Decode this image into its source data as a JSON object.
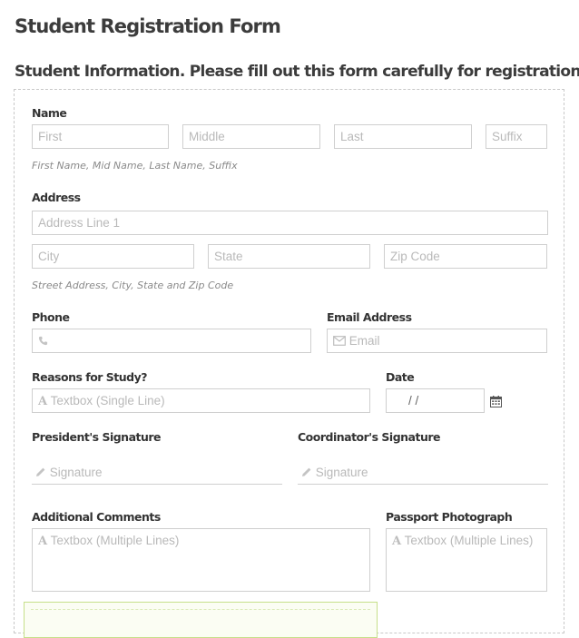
{
  "form": {
    "title": "Student Registration Form"
  },
  "section": {
    "title": "Student Information. Please fill out this form carefully for registration"
  },
  "name": {
    "label": "Name",
    "first_placeholder": "First",
    "middle_placeholder": "Middle",
    "last_placeholder": "Last",
    "suffix_placeholder": "Suffix",
    "hint": "First Name, Mid Name, Last Name, Suffix"
  },
  "address": {
    "label": "Address",
    "line1_placeholder": "Address Line 1",
    "city_placeholder": "City",
    "state_placeholder": "State",
    "zip_placeholder": "Zip Code",
    "hint": "Street Address, City, State and Zip Code"
  },
  "phone": {
    "label": "Phone",
    "icon": "phone-icon"
  },
  "email": {
    "label": "Email Address",
    "placeholder": "Email",
    "icon": "envelope-icon"
  },
  "reasons": {
    "label": "Reasons for Study?",
    "placeholder": "Textbox (Single Line)",
    "icon": "text-icon"
  },
  "date": {
    "label": "Date",
    "value": "/      /",
    "icon": "calendar-icon"
  },
  "president_signature": {
    "label": "President's Signature",
    "placeholder": "Signature",
    "icon": "pencil-icon"
  },
  "coordinator_signature": {
    "label": "Coordinator's Signature",
    "placeholder": "Signature",
    "icon": "pencil-icon"
  },
  "comments": {
    "label": "Additional Comments",
    "placeholder": "Textbox (Multiple Lines)",
    "icon": "text-icon"
  },
  "passport": {
    "label": "Passport Photograph",
    "placeholder": "Textbox (Multiple Lines)",
    "icon": "text-icon"
  },
  "colors": {
    "label": "#333333",
    "placeholder": "#b9b9b9",
    "border": "#cfcfcf",
    "highlight_border": "#c6e08a"
  }
}
